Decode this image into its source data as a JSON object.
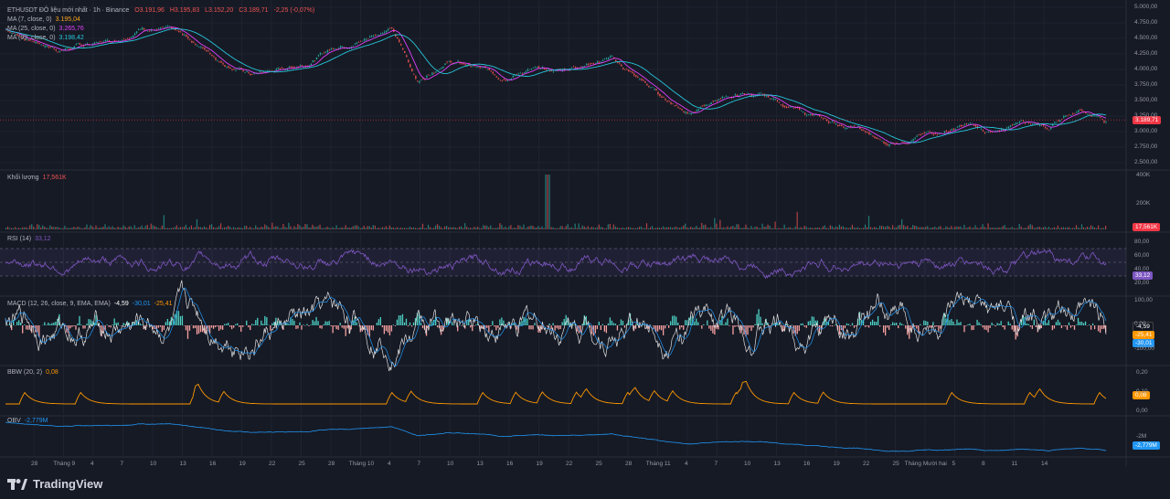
{
  "main": {
    "symbol_line": "ETHUSDT ĐÔ liệu mới nhất · 1h · Binance",
    "ohlc": {
      "o": "O3.191,96",
      "h": "H3.195,83",
      "l": "L3.152,20",
      "c": "C3.189,71",
      "chg": "-2,25 (-0,07%)"
    },
    "ma1": {
      "label": "MA (7, close, 0)",
      "value": "3.195,04",
      "color": "#f7a21b"
    },
    "ma2": {
      "label": "MA (25, close, 0)",
      "value": "3.265,76",
      "color": "#e040fb"
    },
    "ma3": {
      "label": "MA (99, close, 0)",
      "value": "3.198,42",
      "color": "#26c6da"
    },
    "price_tag": "3.189,71",
    "y_ticks": [
      "5.000,00",
      "4.750,00",
      "4.500,00",
      "4.250,00",
      "4.000,00",
      "3.750,00",
      "3.500,00",
      "3.250,00",
      "3.000,00",
      "2.750,00",
      "2.500,00"
    ]
  },
  "volume": {
    "label": "Khối lượng",
    "value": "17,561K",
    "tag": "17,561K",
    "y_ticks": [
      "400K",
      "200K"
    ]
  },
  "rsi": {
    "label": "RSI (14)",
    "value": "33,12",
    "tag": "33,12",
    "y_ticks": [
      "80,00",
      "60,00",
      "40,00",
      "20,00"
    ]
  },
  "macd": {
    "label": "MACD (12, 26, close, 9, EMA, EMA)",
    "v1": "-4,59",
    "v2": "-30,01",
    "v3": "-25,41",
    "tags": [
      "-4,59",
      "-25,41",
      "-30,01"
    ],
    "y_ticks": [
      "100,00",
      "0,00",
      "-100,00"
    ]
  },
  "bbw": {
    "label": "BBW (20, 2)",
    "value": "0,08",
    "tag": "0,08",
    "y_ticks": [
      "0,20",
      "0,10",
      "0,00"
    ]
  },
  "obv": {
    "label": "OBV",
    "value": "-2,779M",
    "tag": "-2,779M",
    "y_ticks": [
      "-2M"
    ]
  },
  "x_ticks": [
    "28",
    "Tháng 9",
    "4",
    "7",
    "10",
    "13",
    "16",
    "19",
    "22",
    "25",
    "28",
    "Tháng 10",
    "4",
    "7",
    "10",
    "13",
    "16",
    "19",
    "22",
    "25",
    "28",
    "Tháng 11",
    "4",
    "7",
    "10",
    "13",
    "16",
    "19",
    "22",
    "25",
    "Tháng Mười hai",
    "5",
    "8",
    "11",
    "14"
  ],
  "brand": "TradingView",
  "chart_data": {
    "type": "line",
    "title": "",
    "series": [
      {
        "name": "ETHUSDT",
        "values": [
          4650,
          4460,
          4320,
          4400,
          4480,
          4700,
          4620,
          4400,
          4100,
          3920,
          4000,
          4120,
          4380,
          4480,
          4700,
          3800,
          4150,
          4050,
          3880,
          4000,
          3960,
          4100,
          4180,
          3850,
          3520,
          3300,
          3560,
          3600,
          3500,
          3300,
          3150,
          3050,
          2780,
          2920,
          3000,
          3100,
          2950,
          3220,
          3100,
          3380,
          3190
        ]
      }
    ]
  }
}
